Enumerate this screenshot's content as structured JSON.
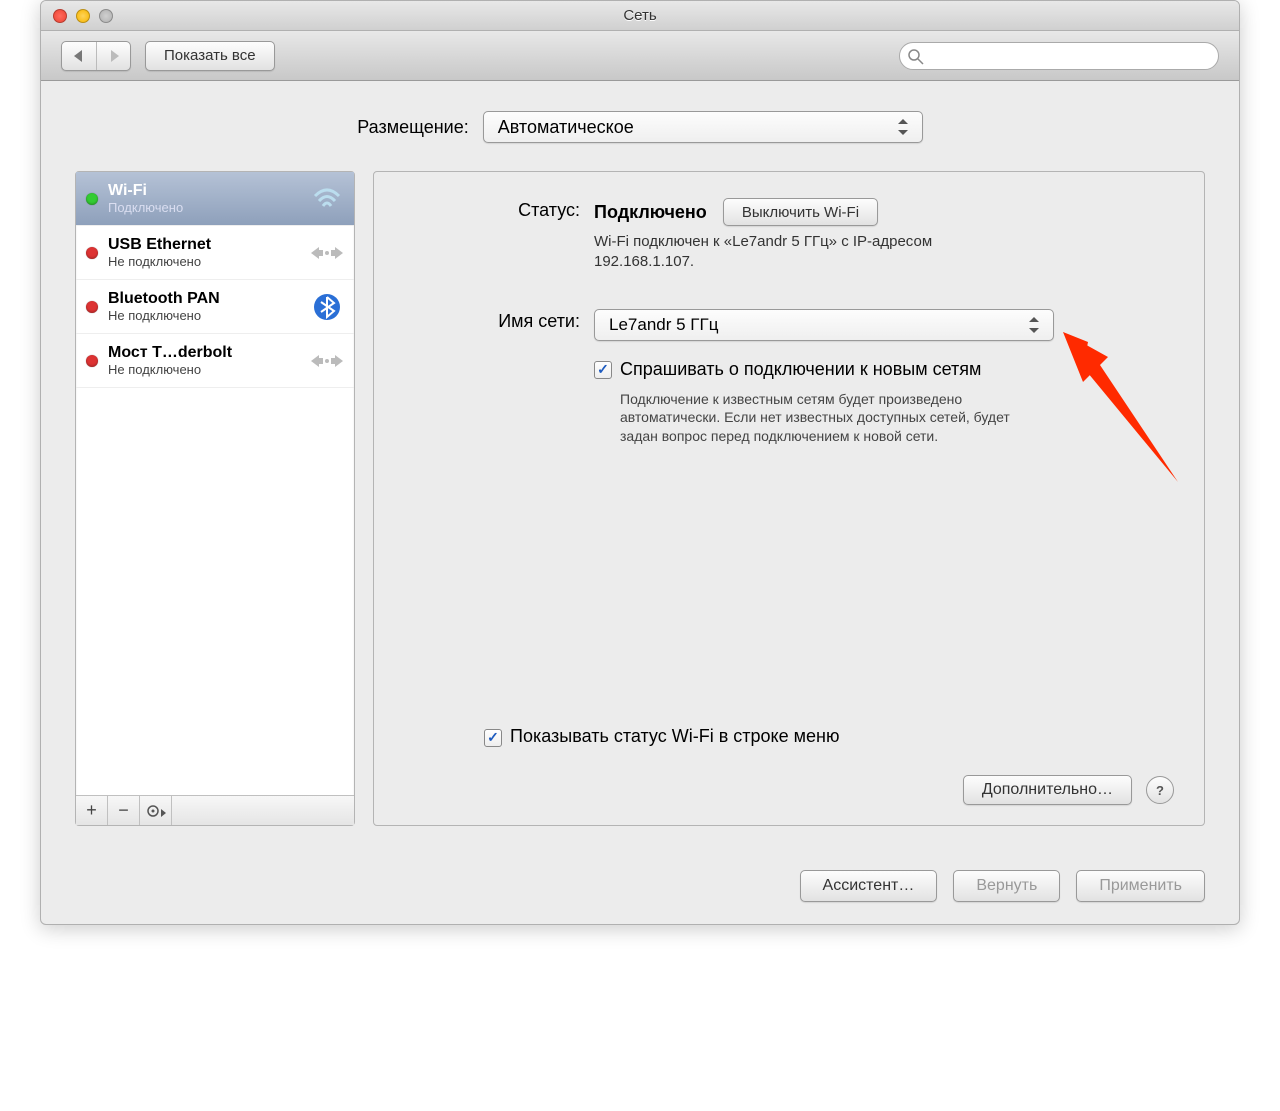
{
  "window": {
    "title": "Сеть"
  },
  "toolbar": {
    "show_all": "Показать все",
    "search_placeholder": ""
  },
  "location": {
    "label": "Размещение:",
    "value": "Автоматическое"
  },
  "sidebar": {
    "items": [
      {
        "name": "Wi-Fi",
        "status": "Подключено",
        "dot": "green",
        "icon": "wifi",
        "selected": true
      },
      {
        "name": "USB Ethernet",
        "status": "Не подключено",
        "dot": "red",
        "icon": "ethernet",
        "selected": false
      },
      {
        "name": "Bluetooth PAN",
        "status": "Не подключено",
        "dot": "red",
        "icon": "bluetooth",
        "selected": false
      },
      {
        "name": "Мост T…derbolt",
        "status": "Не подключено",
        "dot": "red",
        "icon": "ethernet",
        "selected": false
      }
    ]
  },
  "detail": {
    "status_label": "Статус:",
    "status_value": "Подключено",
    "toggle_wifi": "Выключить Wi-Fi",
    "status_desc": "Wi-Fi подключен к «Le7andr 5 ГГц» с IP-адресом 192.168.1.107.",
    "network_label": "Имя сети:",
    "network_value": "Le7andr 5 ГГц",
    "ask_join": "Спрашивать о подключении к новым сетям",
    "ask_join_help": "Подключение к известным сетям будет произведено автоматически. Если нет известных доступных сетей, будет задан вопрос перед подключением к новой сети.",
    "show_status": "Показывать статус Wi-Fi в строке меню",
    "advanced": "Дополнительно…"
  },
  "footer": {
    "assistant": "Ассистент…",
    "revert": "Вернуть",
    "apply": "Применить"
  }
}
